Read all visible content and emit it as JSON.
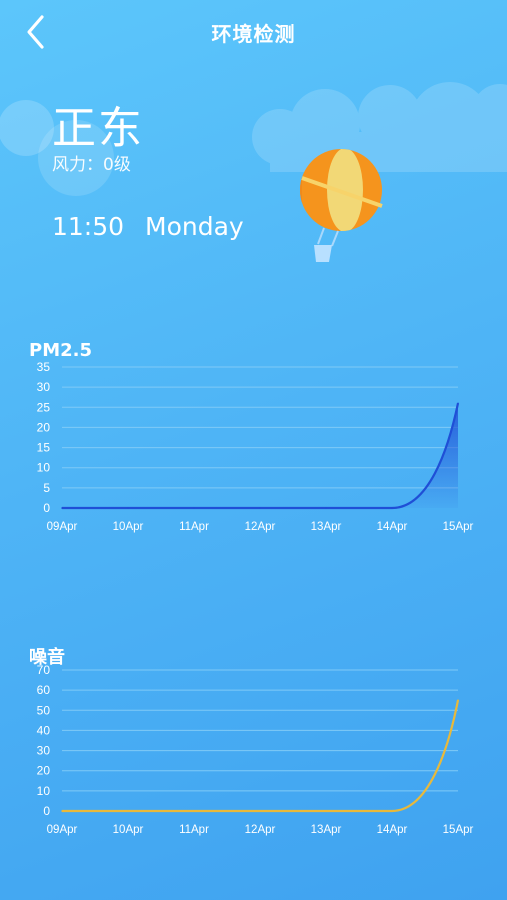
{
  "header": {
    "title": "环境检测",
    "back_icon": "chevron-left-icon"
  },
  "wind": {
    "direction": "正东",
    "level_label": "风力：",
    "level_value": "0级"
  },
  "time": "11:50",
  "weekday": "Monday",
  "decorations": {
    "balloon_icon": "hot-air-balloon-icon",
    "cloud_icon": "cloud-icon"
  },
  "colors": {
    "pm_line": "#1f4fd6",
    "noise_line": "#e8b93b",
    "grid": "#7fcaf7"
  },
  "chart_data": [
    {
      "type": "area",
      "title": "PM2.5",
      "categories": [
        "09Apr",
        "10Apr",
        "11Apr",
        "12Apr",
        "13Apr",
        "14Apr",
        "15Apr"
      ],
      "yticks": [
        "0",
        "5",
        "10",
        "15",
        "20",
        "25",
        "30",
        "35"
      ],
      "ylim": [
        0,
        35
      ],
      "series": [
        {
          "values": [
            0,
            0,
            0,
            0,
            0,
            0,
            26
          ]
        }
      ],
      "grid": true
    },
    {
      "type": "line",
      "title": "噪音",
      "categories": [
        "09Apr",
        "10Apr",
        "11Apr",
        "12Apr",
        "13Apr",
        "14Apr",
        "15Apr"
      ],
      "yticks": [
        "0",
        "10",
        "20",
        "30",
        "40",
        "50",
        "60",
        "70"
      ],
      "ylim": [
        0,
        70
      ],
      "series": [
        {
          "values": [
            0,
            0,
            0,
            0,
            0,
            0,
            55
          ]
        }
      ],
      "grid": true
    }
  ]
}
